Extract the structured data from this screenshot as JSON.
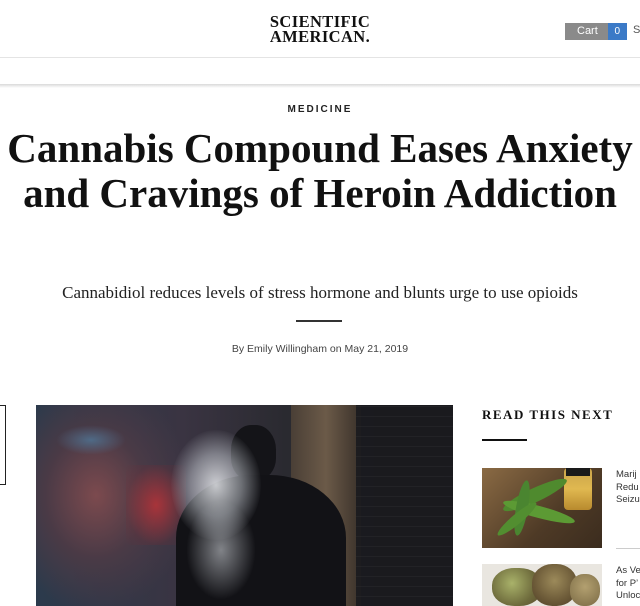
{
  "header": {
    "logo_line1": "SCIENTIFIC",
    "logo_line2": "AMERICAN.",
    "cart_label": "Cart",
    "cart_count": "0",
    "cut_off_label": "S"
  },
  "article": {
    "section": "MEDICINE",
    "headline": "Cannabis Compound Eases Anxiety and Cravings of Heroin Addiction",
    "subhead": "Cannabidiol reduces levels of stress hormone and blunts urge to use opioids",
    "byline": "By Emily Willingham on May 21, 2019"
  },
  "sidebar": {
    "heading": "READ THIS NEXT",
    "items": [
      {
        "lines": [
          "Marij",
          "Redu",
          "Seizu"
        ]
      },
      {
        "lines": [
          "As Ve",
          "for P’",
          "Unloc"
        ]
      }
    ]
  },
  "colors": {
    "cart_gray": "#8a8a8a",
    "cart_blue": "#3b7ac7",
    "text": "#111111"
  },
  "icons": {
    "hero_image": "man-exhaling-smoke-photo",
    "thumb1": "cannabis-leaf-oil-bottle-photo",
    "thumb2": "cannabis-buds-photo"
  }
}
